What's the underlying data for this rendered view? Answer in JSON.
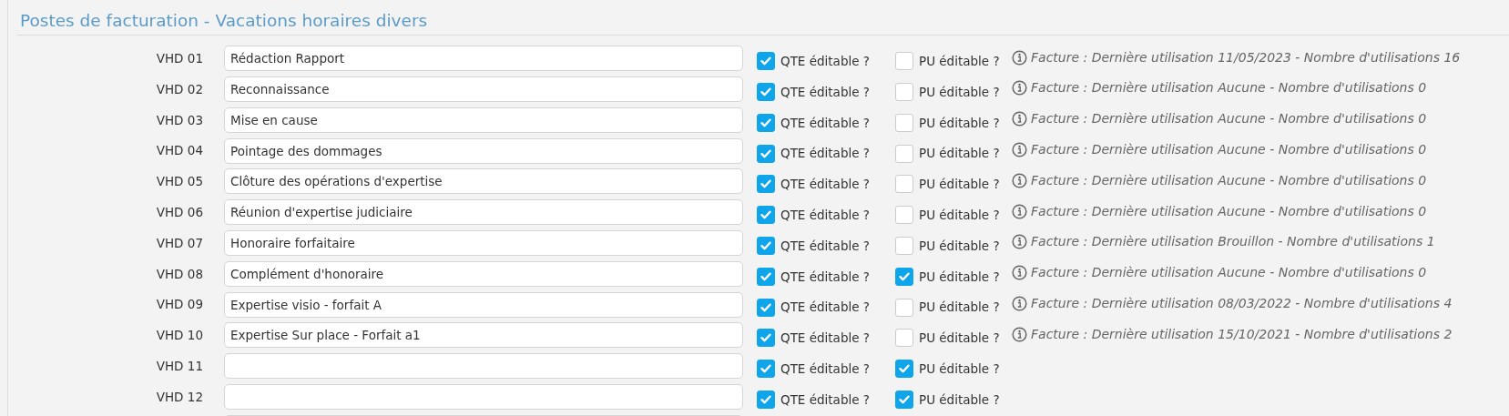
{
  "section": {
    "title": "Postes de facturation - Vacations horaires divers"
  },
  "rows": [
    {
      "code": "VHD 01",
      "value": "Rédaction Rapport",
      "qte_label": "QTE éditable ?",
      "qte_checked": true,
      "pu_label": "PU éditable ?",
      "pu_checked": false,
      "info": "Facture : Dernière utilisation 11/05/2023 - Nombre d'utilisations 16"
    },
    {
      "code": "VHD 02",
      "value": "Reconnaissance",
      "qte_label": "QTE éditable ?",
      "qte_checked": true,
      "pu_label": "PU éditable ?",
      "pu_checked": false,
      "info": "Facture : Dernière utilisation Aucune - Nombre d'utilisations 0"
    },
    {
      "code": "VHD 03",
      "value": "Mise en cause",
      "qte_label": "QTE éditable ?",
      "qte_checked": true,
      "pu_label": "PU éditable ?",
      "pu_checked": false,
      "info": "Facture : Dernière utilisation Aucune - Nombre d'utilisations 0"
    },
    {
      "code": "VHD 04",
      "value": "Pointage des dommages",
      "qte_label": "QTE éditable ?",
      "qte_checked": true,
      "pu_label": "PU éditable ?",
      "pu_checked": false,
      "info": "Facture : Dernière utilisation Aucune - Nombre d'utilisations 0"
    },
    {
      "code": "VHD 05",
      "value": "Clôture des opérations d'expertise",
      "qte_label": "QTE éditable ?",
      "qte_checked": true,
      "pu_label": "PU éditable ?",
      "pu_checked": false,
      "info": "Facture : Dernière utilisation Aucune - Nombre d'utilisations 0"
    },
    {
      "code": "VHD 06",
      "value": "Réunion d'expertise judiciaire",
      "qte_label": "QTE éditable ?",
      "qte_checked": true,
      "pu_label": "PU éditable ?",
      "pu_checked": false,
      "info": "Facture : Dernière utilisation Aucune - Nombre d'utilisations 0"
    },
    {
      "code": "VHD 07",
      "value": "Honoraire forfaitaire",
      "qte_label": "QTE éditable ?",
      "qte_checked": true,
      "pu_label": "PU éditable ?",
      "pu_checked": false,
      "info": "Facture : Dernière utilisation Brouillon - Nombre d'utilisations 1"
    },
    {
      "code": "VHD 08",
      "value": "Complément d'honoraire",
      "qte_label": "QTE éditable ?",
      "qte_checked": true,
      "pu_label": "PU éditable ?",
      "pu_checked": true,
      "info": "Facture : Dernière utilisation Aucune - Nombre d'utilisations 0"
    },
    {
      "code": "VHD 09",
      "value": "Expertise visio - forfait A",
      "qte_label": "QTE éditable ?",
      "qte_checked": true,
      "pu_label": "PU éditable ?",
      "pu_checked": false,
      "info": "Facture : Dernière utilisation 08/03/2022 - Nombre d'utilisations 4"
    },
    {
      "code": "VHD 10",
      "value": "Expertise Sur place - Forfait a1",
      "qte_label": "QTE éditable ?",
      "qte_checked": true,
      "pu_label": "PU éditable ?",
      "pu_checked": false,
      "info": "Facture : Dernière utilisation 15/10/2021 - Nombre d'utilisations 2"
    },
    {
      "code": "VHD 11",
      "qte_label": "QTE éditable ?",
      "qte_checked": true,
      "pu_label": "PU éditable ?",
      "pu_checked": true
    },
    {
      "code": "VHD 12",
      "qte_label": "QTE éditable ?",
      "qte_checked": true,
      "pu_label": "PU éditable ?",
      "pu_checked": true
    },
    {}
  ]
}
